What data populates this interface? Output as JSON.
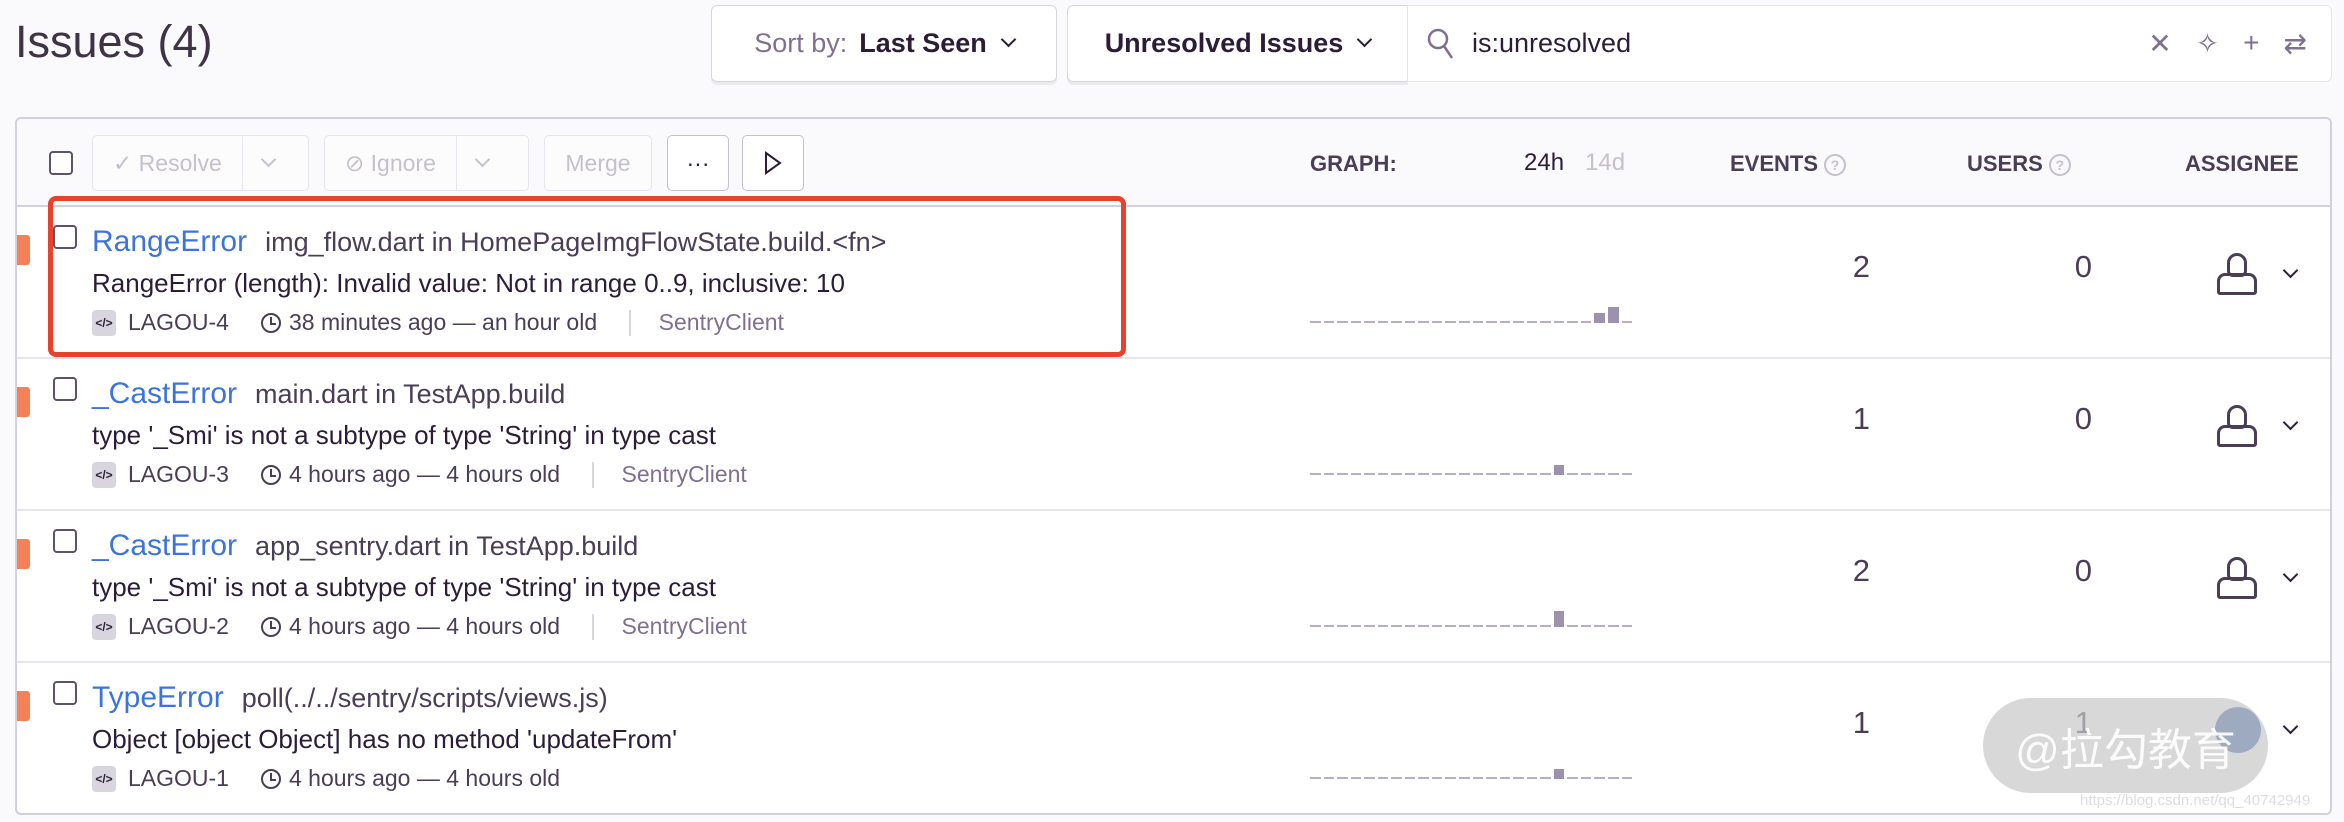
{
  "title": "Issues (4)",
  "sort": {
    "label": "Sort by:",
    "value": "Last Seen"
  },
  "filter": {
    "value": "Unresolved Issues"
  },
  "search": {
    "value": "is:unresolved"
  },
  "toolbar": {
    "resolve": "Resolve",
    "ignore": "Ignore",
    "merge": "Merge",
    "more": "···"
  },
  "columns": {
    "graph": "GRAPH:",
    "period_24h": "24h",
    "period_14d": "14d",
    "events": "EVENTS",
    "users": "USERS",
    "assignee": "ASSIGNEE"
  },
  "issues": [
    {
      "type": "RangeError",
      "location": "img_flow.dart in HomePageImgFlowState.build.<fn>",
      "message": "RangeError (length): Invalid value: Not in range 0..9, inclusive: 10",
      "id": "LAGOU-4",
      "time": "38 minutes ago — an hour old",
      "client": "SentryClient",
      "events": "2",
      "users": "0",
      "sparkline": [
        0,
        0,
        0,
        0,
        0,
        0,
        0,
        0,
        0,
        0,
        0,
        0,
        0,
        0,
        0,
        0,
        0,
        0,
        0,
        0,
        0,
        1,
        2,
        0
      ],
      "highlighted": true
    },
    {
      "type": "_CastError",
      "location": "main.dart in TestApp.build",
      "message": "type '_Smi' is not a subtype of type 'String' in type cast",
      "id": "LAGOU-3",
      "time": "4 hours ago — 4 hours old",
      "client": "SentryClient",
      "events": "1",
      "users": "0",
      "sparkline": [
        0,
        0,
        0,
        0,
        0,
        0,
        0,
        0,
        0,
        0,
        0,
        0,
        0,
        0,
        0,
        0,
        0,
        0,
        1,
        0,
        0,
        0,
        0,
        0
      ]
    },
    {
      "type": "_CastError",
      "location": "app_sentry.dart in TestApp.build",
      "message": "type '_Smi' is not a subtype of type 'String' in type cast",
      "id": "LAGOU-2",
      "time": "4 hours ago — 4 hours old",
      "client": "SentryClient",
      "events": "2",
      "users": "0",
      "sparkline": [
        0,
        0,
        0,
        0,
        0,
        0,
        0,
        0,
        0,
        0,
        0,
        0,
        0,
        0,
        0,
        0,
        0,
        0,
        2,
        0,
        0,
        0,
        0,
        0
      ]
    },
    {
      "type": "TypeError",
      "location": "poll(../../sentry/scripts/views.js)",
      "message": "Object [object Object] has no method 'updateFrom'",
      "id": "LAGOU-1",
      "time": "4 hours ago — 4 hours old",
      "client": "",
      "events": "1",
      "users": "1",
      "sparkline": [
        0,
        0,
        0,
        0,
        0,
        0,
        0,
        0,
        0,
        0,
        0,
        0,
        0,
        0,
        0,
        0,
        0,
        0,
        1,
        0,
        0,
        0,
        0,
        0
      ],
      "assigned": true
    }
  ],
  "watermark": {
    "text": "@拉勾教育",
    "url": "https://blog.csdn.net/qq_40742949"
  },
  "colors": {
    "accent": "#3d74db",
    "level": "#f58159",
    "highlight": "#e8412c"
  }
}
